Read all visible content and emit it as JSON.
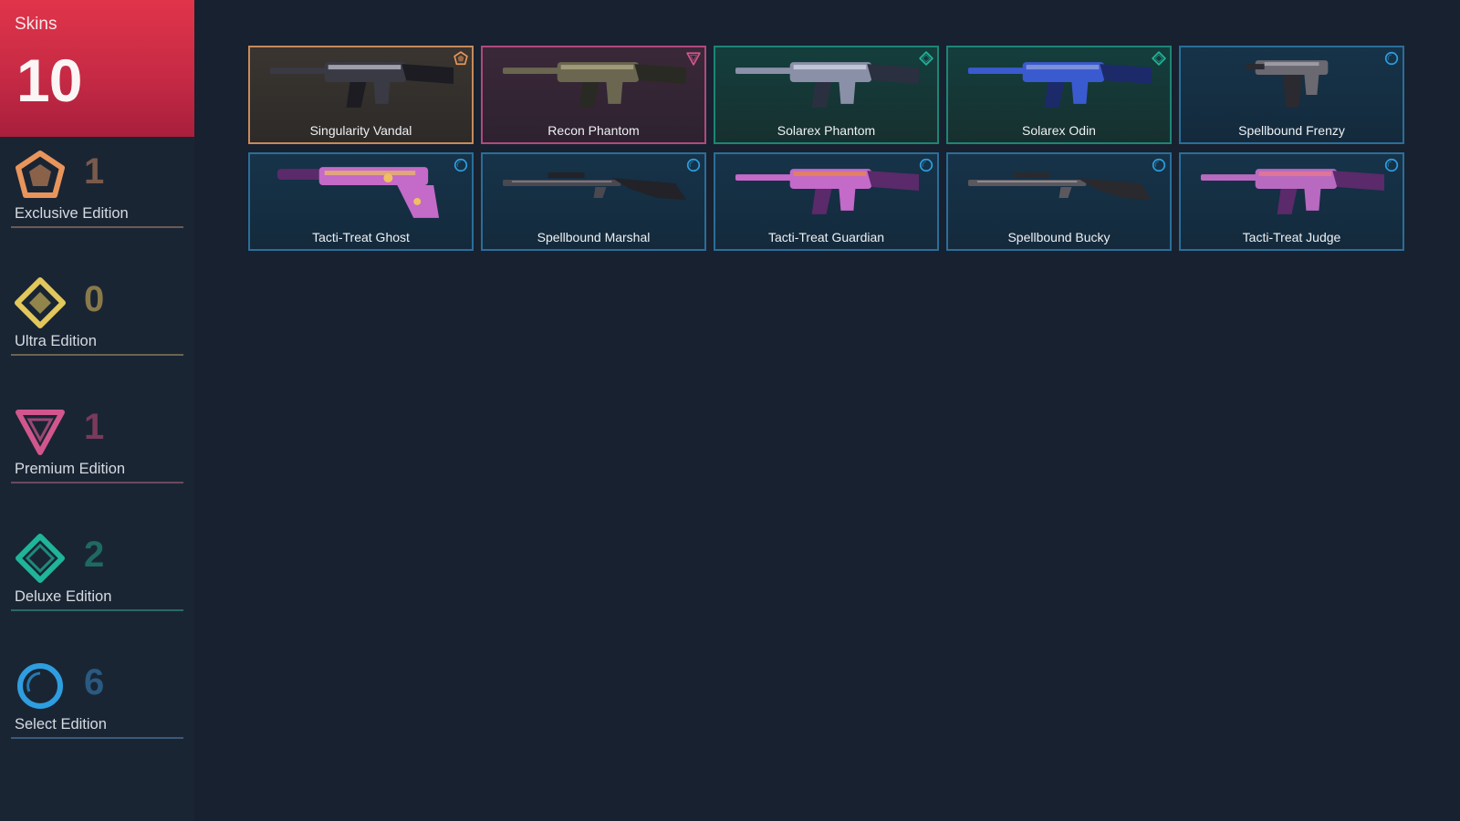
{
  "summary": {
    "label": "Skins",
    "total": "10"
  },
  "tiers": [
    {
      "name": "Exclusive Edition",
      "count": "1",
      "icon": "exclusive-edition-icon",
      "color": "#e8955c",
      "countColor": "#7a5a4a",
      "line": "#6a5a55"
    },
    {
      "name": "Ultra Edition",
      "count": "0",
      "icon": "ultra-edition-icon",
      "color": "#e2c75c",
      "countColor": "#8a7a4a",
      "line": "#6a6550"
    },
    {
      "name": "Premium Edition",
      "count": "1",
      "icon": "premium-edition-icon",
      "color": "#d2568e",
      "countColor": "#7a3a5c",
      "line": "#6a4a5c"
    },
    {
      "name": "Deluxe Edition",
      "count": "2",
      "icon": "deluxe-edition-icon",
      "color": "#1fb59a",
      "countColor": "#1f6a60",
      "line": "#2a6a62"
    },
    {
      "name": "Select Edition",
      "count": "6",
      "icon": "select-edition-icon",
      "color": "#2e9ee0",
      "countColor": "#2a5a80",
      "line": "#3a5a78"
    }
  ],
  "skins": [
    {
      "name": "Singularity Vandal",
      "tier": "exclusive",
      "palette": [
        "#1c1c22",
        "#3a3a44",
        "#c7c7d8"
      ]
    },
    {
      "name": "Recon Phantom",
      "tier": "premium",
      "palette": [
        "#2a2a24",
        "#6a6650",
        "#b8b08a"
      ]
    },
    {
      "name": "Solarex Phantom",
      "tier": "deluxe",
      "palette": [
        "#2a3040",
        "#8a90a8",
        "#d8dcec"
      ]
    },
    {
      "name": "Solarex Odin",
      "tier": "deluxe",
      "palette": [
        "#1c2a6a",
        "#3a5ad0",
        "#9aa8e0"
      ]
    },
    {
      "name": "Spellbound Frenzy",
      "tier": "select",
      "palette": [
        "#2a2a30",
        "#6a6870",
        "#c0bcc6"
      ]
    },
    {
      "name": "Tacti-Treat Ghost",
      "tier": "select",
      "palette": [
        "#5a2a6a",
        "#c46ac8",
        "#f0c060"
      ]
    },
    {
      "name": "Spellbound Marshal",
      "tier": "select",
      "palette": [
        "#222228",
        "#4a4850",
        "#9a98a0"
      ]
    },
    {
      "name": "Tacti-Treat Guardian",
      "tier": "select",
      "palette": [
        "#5a2a6a",
        "#c46ac8",
        "#f08a3a"
      ]
    },
    {
      "name": "Spellbound Bucky",
      "tier": "select",
      "palette": [
        "#2a2a2e",
        "#5a585e",
        "#b0acb4"
      ]
    },
    {
      "name": "Tacti-Treat Judge",
      "tier": "select",
      "palette": [
        "#5a2a6a",
        "#b86ac0",
        "#f07a8a"
      ]
    }
  ]
}
